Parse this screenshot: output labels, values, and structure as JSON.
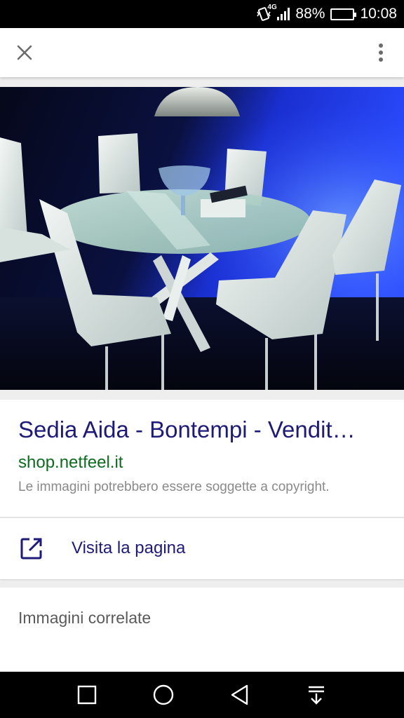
{
  "status_bar": {
    "network_type": "4G",
    "battery_percent": "88%",
    "battery_level": 0.88,
    "time": "10:08",
    "icons": [
      "vibrate-icon",
      "signal-icon",
      "battery-icon"
    ]
  },
  "app_bar": {
    "close_icon": "close-icon",
    "more_icon": "more-vert-icon"
  },
  "result": {
    "title": "Sedia Aida - Bontempi - Vendit…",
    "domain": "shop.netfeel.it",
    "copyright_notice": "Le immagini potrebbero essere soggette a copyright.",
    "visit_label": "Visita la pagina",
    "visit_icon": "open-in-new-icon"
  },
  "related": {
    "title": "Immagini correlate"
  },
  "nav_bar": {
    "icons": [
      "recents-square-icon",
      "home-circle-icon",
      "back-triangle-icon",
      "notification-pull-icon"
    ]
  },
  "colors": {
    "title_link": "#1e1a78",
    "domain_green": "#0d6b1f",
    "muted_text": "#8a8a8a",
    "background": "#eeeeee"
  }
}
